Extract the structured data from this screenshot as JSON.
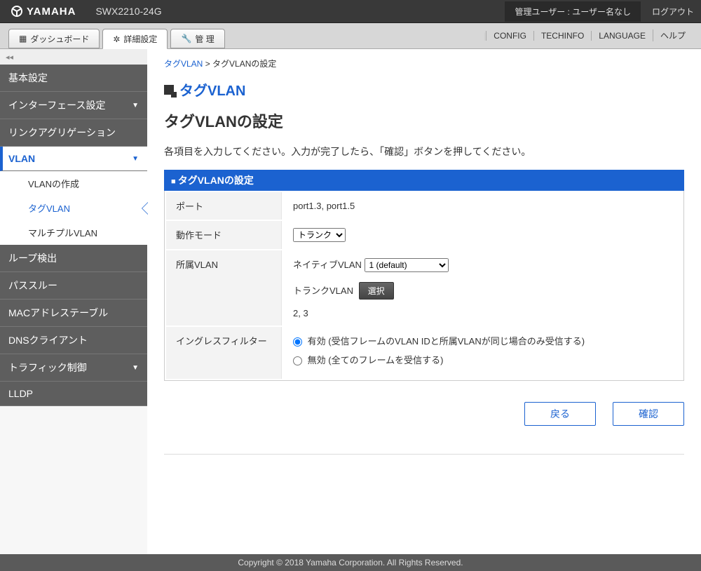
{
  "header": {
    "brand": "YAMAHA",
    "device": "SWX2210-24G",
    "admin_label": "管理ユーザー : ユーザー名なし",
    "logout": "ログアウト"
  },
  "tabs": {
    "dashboard": "ダッシュボード",
    "detail": "詳細設定",
    "manage": "管 理"
  },
  "util": {
    "config": "CONFIG",
    "techinfo": "TECHINFO",
    "language": "LANGUAGE",
    "help": "ヘルプ"
  },
  "sidebar": {
    "basic": "基本設定",
    "interface": "インターフェース設定",
    "linkagg": "リンクアグリゲーション",
    "vlan": "VLAN",
    "vlan_sub": {
      "create": "VLANの作成",
      "tag": "タグVLAN",
      "multi": "マルチプルVLAN"
    },
    "loop": "ループ検出",
    "passthrough": "パススルー",
    "mac": "MACアドレステーブル",
    "dns": "DNSクライアント",
    "traffic": "トラフィック制御",
    "lldp": "LLDP"
  },
  "breadcrumb": {
    "parent": "タグVLAN",
    "current": "タグVLANの設定"
  },
  "page": {
    "heading_icon_title": "タグVLAN",
    "section_title": "タグVLANの設定",
    "instruction": "各項目を入力してください。入力が完了したら、「確認」ボタンを押してください。",
    "panel_title": "タグVLANの設定"
  },
  "form": {
    "port_label": "ポート",
    "port_value": "port1.3, port1.5",
    "mode_label": "動作モード",
    "mode_options": [
      "トランク"
    ],
    "belong_label": "所属VLAN",
    "native_label": "ネイティブVLAN",
    "native_options": [
      "1 (default)"
    ],
    "trunk_label": "トランクVLAN",
    "select_btn": "選択",
    "trunk_values": "2, 3",
    "ingress_label": "イングレスフィルター",
    "ingress_enable": "有効 (受信フレームのVLAN IDと所属VLANが同じ場合のみ受信する)",
    "ingress_disable": "無効 (全てのフレームを受信する)"
  },
  "actions": {
    "back": "戻る",
    "confirm": "確認"
  },
  "footer": {
    "text": "Copyright © 2018 Yamaha Corporation. All Rights Reserved."
  }
}
